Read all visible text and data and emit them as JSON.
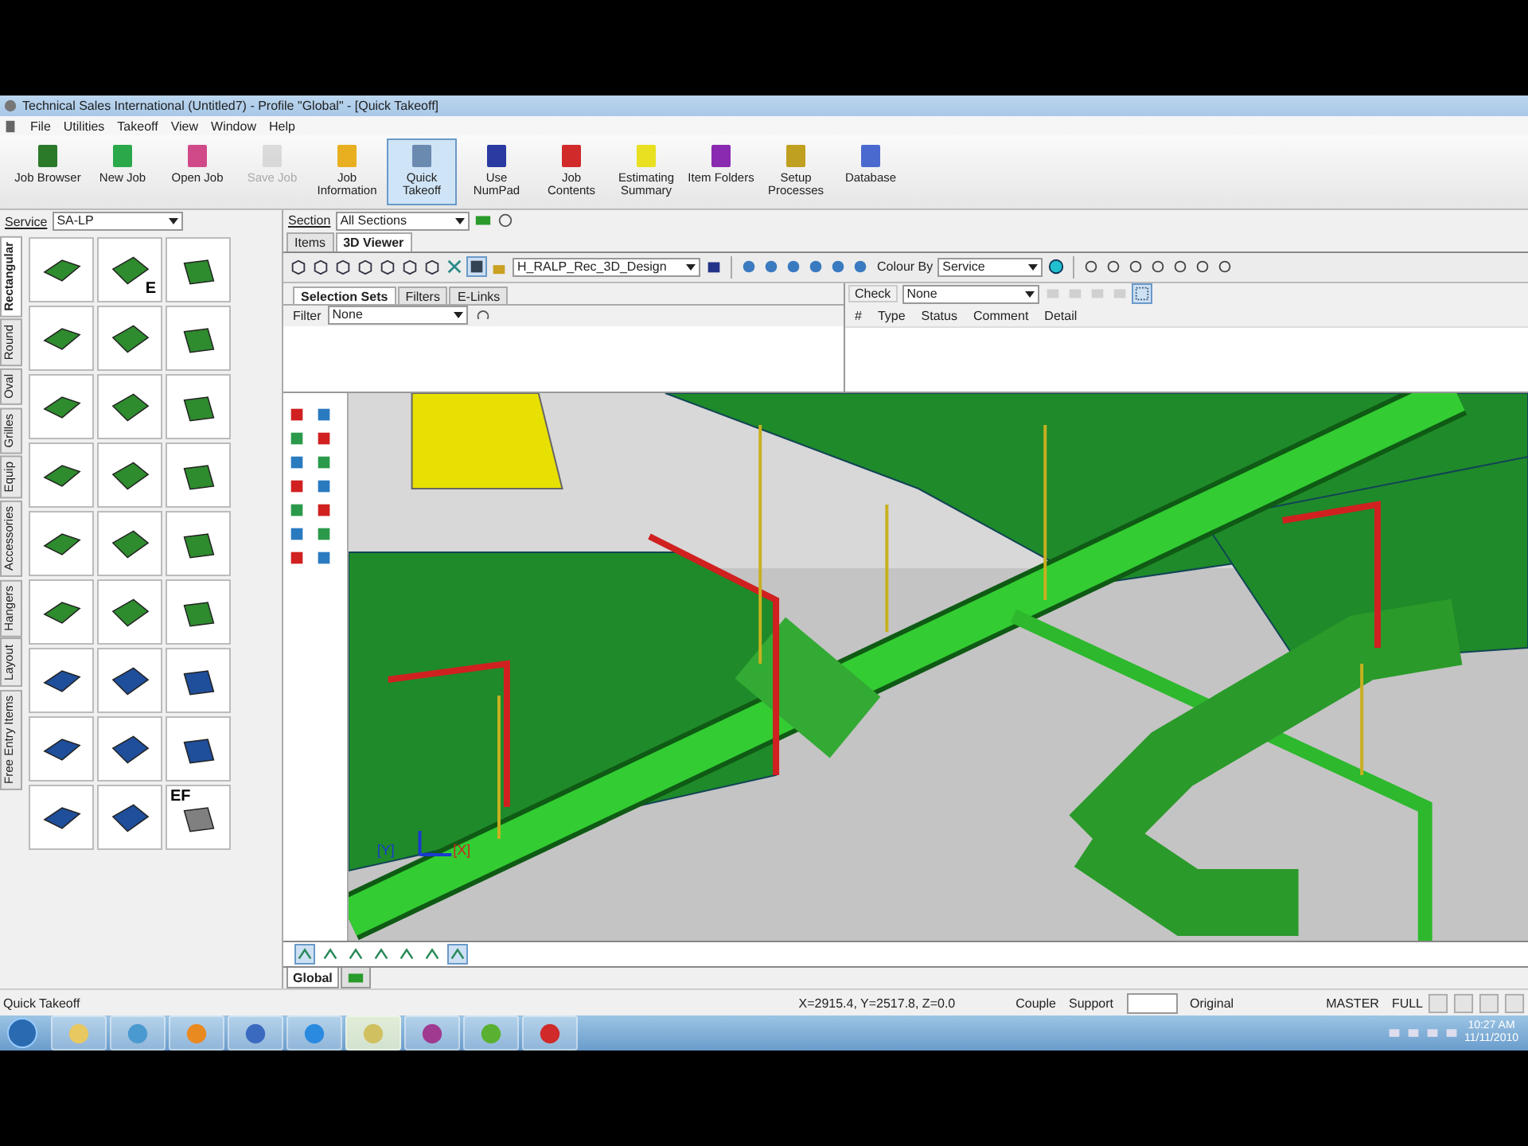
{
  "window": {
    "title": "Technical Sales International (Untitled7) - Profile \"Global\" - [Quick Takeoff]"
  },
  "menu": [
    "File",
    "Utilities",
    "Takeoff",
    "View",
    "Window",
    "Help"
  ],
  "toolbar": [
    {
      "label": "Job Browser",
      "kind": "browser",
      "selected": false,
      "disabled": false
    },
    {
      "label": "New Job",
      "kind": "new",
      "selected": false,
      "disabled": false
    },
    {
      "label": "Open Job",
      "kind": "open",
      "selected": false,
      "disabled": false
    },
    {
      "label": "Save Job",
      "kind": "save",
      "selected": false,
      "disabled": true
    },
    {
      "label": "Job Information",
      "kind": "info",
      "selected": false,
      "disabled": false
    },
    {
      "label": "Quick Takeoff",
      "kind": "takeoff",
      "selected": true,
      "disabled": false
    },
    {
      "label": "Use NumPad",
      "kind": "numpad",
      "selected": false,
      "disabled": false
    },
    {
      "label": "Job Contents",
      "kind": "contents",
      "selected": false,
      "disabled": false
    },
    {
      "label": "Estimating Summary",
      "kind": "summary",
      "selected": false,
      "disabled": false
    },
    {
      "label": "Item Folders",
      "kind": "folders",
      "selected": false,
      "disabled": false
    },
    {
      "label": "Setup Processes",
      "kind": "setup",
      "selected": false,
      "disabled": false
    },
    {
      "label": "Database",
      "kind": "database",
      "selected": false,
      "disabled": false
    }
  ],
  "service": {
    "label": "Service",
    "value": "SA-LP"
  },
  "category_tabs": [
    {
      "label": "Rectangular",
      "selected": true
    },
    {
      "label": "Round",
      "selected": false
    },
    {
      "label": "Oval",
      "selected": false
    },
    {
      "label": "Grilles",
      "selected": false
    },
    {
      "label": "Equip",
      "selected": false
    },
    {
      "label": "Accessories",
      "selected": false
    },
    {
      "label": "Hangers",
      "selected": false
    },
    {
      "label": "Layout",
      "selected": false
    },
    {
      "label": "Free Entry Items",
      "selected": false
    }
  ],
  "fittings": [
    {
      "color": "#2e8b2e"
    },
    {
      "color": "#2e8b2e",
      "label": "E"
    },
    {
      "color": "#2e8b2e"
    },
    {
      "color": "#2e8b2e"
    },
    {
      "color": "#2e8b2e"
    },
    {
      "color": "#2e8b2e"
    },
    {
      "color": "#2e8b2e"
    },
    {
      "color": "#2e8b2e"
    },
    {
      "color": "#2e8b2e"
    },
    {
      "color": "#2e8b2e"
    },
    {
      "color": "#2e8b2e"
    },
    {
      "color": "#2e8b2e"
    },
    {
      "color": "#2e8b2e"
    },
    {
      "color": "#2e8b2e"
    },
    {
      "color": "#2e8b2e"
    },
    {
      "color": "#2e8b2e"
    },
    {
      "color": "#2e8b2e"
    },
    {
      "color": "#2e8b2e"
    },
    {
      "color": "#1f4e9a"
    },
    {
      "color": "#1f4e9a"
    },
    {
      "color": "#1f4e9a"
    },
    {
      "color": "#1f4e9a"
    },
    {
      "color": "#1f4e9a"
    },
    {
      "color": "#1f4e9a"
    },
    {
      "color": "#1f4e9a"
    },
    {
      "color": "#1f4e9a"
    },
    {
      "color": "#808080",
      "label": "EF"
    }
  ],
  "section": {
    "label": "Section",
    "value": "All Sections"
  },
  "main_tabs": [
    {
      "label": "Items",
      "selected": false
    },
    {
      "label": "3D Viewer",
      "selected": true
    }
  ],
  "viewer_toolbar": {
    "design": "H_RALP_Rec_3D_Design",
    "colour_by_label": "Colour By",
    "colour_by": "Service"
  },
  "selection_tabs": [
    {
      "label": "Selection Sets",
      "selected": true
    },
    {
      "label": "Filters",
      "selected": false
    },
    {
      "label": "E-Links",
      "selected": false
    }
  ],
  "filter": {
    "label": "Filter",
    "value": "None"
  },
  "check": {
    "label": "Check",
    "value": "None",
    "columns": [
      "#",
      "Type",
      "Status",
      "Comment",
      "Detail"
    ]
  },
  "axis_labels": [
    "[Y]",
    "[X]"
  ],
  "bottom_tabs": [
    {
      "kind": "text",
      "label": "Global",
      "selected": true
    },
    {
      "kind": "icon",
      "selected": false
    }
  ],
  "status_bar": {
    "mode": "Quick Takeoff",
    "coords": "X=2915.4, Y=2517.8, Z=0.0",
    "couple": "Couple",
    "support": "Support",
    "original": "Original",
    "master": "MASTER",
    "full": "FULL"
  },
  "taskbar": {
    "time": "10:27 AM",
    "date": "11/11/2010"
  }
}
